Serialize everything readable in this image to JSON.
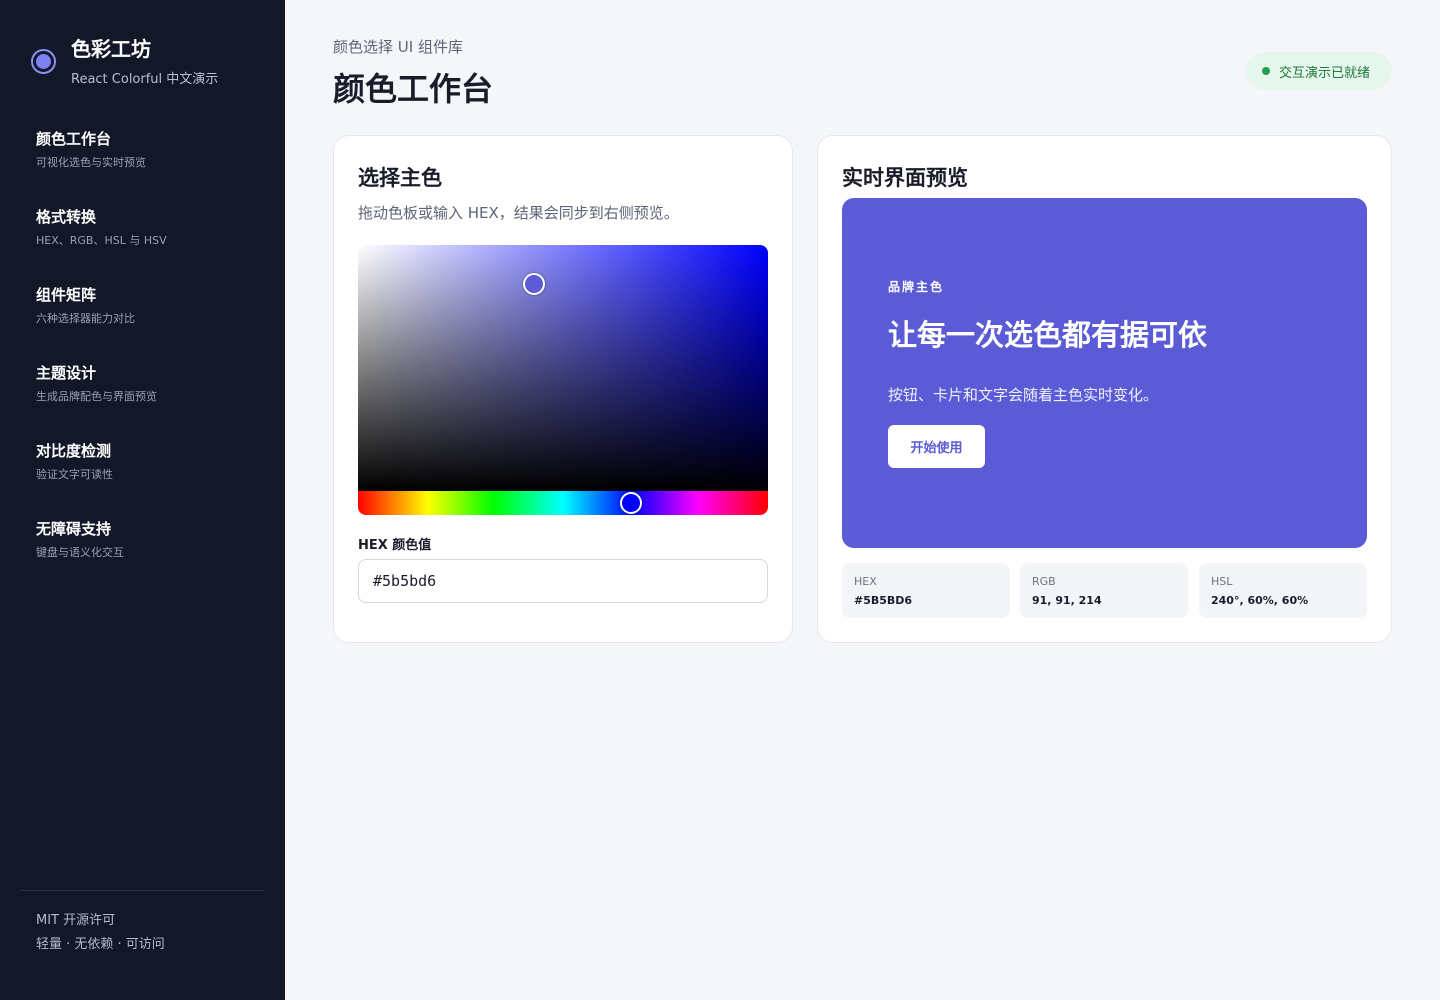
{
  "brand": {
    "title": "色彩工坊",
    "subtitle": "React Colorful 中文演示"
  },
  "nav": [
    {
      "title": "颜色工作台",
      "desc": "可视化选色与实时预览"
    },
    {
      "title": "格式转换",
      "desc": "HEX、RGB、HSL 与 HSV"
    },
    {
      "title": "组件矩阵",
      "desc": "六种选择器能力对比"
    },
    {
      "title": "主题设计",
      "desc": "生成品牌配色与界面预览"
    },
    {
      "title": "对比度检测",
      "desc": "验证文字可读性"
    },
    {
      "title": "无障碍支持",
      "desc": "键盘与语义化交互"
    }
  ],
  "footer": {
    "license": "MIT 开源许可",
    "tagline": "轻量 · 无依赖 · 可访问"
  },
  "header": {
    "kicker": "颜色选择 UI 组件库",
    "title": "颜色工作台",
    "status": "交互演示已就绪"
  },
  "picker": {
    "title": "选择主色",
    "desc": "拖动色板或输入 HEX，结果会同步到右侧预览。",
    "hex_label": "HEX 颜色值",
    "hex_value": "#5b5bd6",
    "hue": 240,
    "saturation_hsv": 0.43,
    "value_hsv": 0.84
  },
  "preview": {
    "title": "实时界面预览",
    "kicker": "品牌主色",
    "headline": "让每一次选色都有据可依",
    "desc": "按钮、卡片和文字会随着主色实时变化。",
    "button": "开始使用",
    "color": "#5b5bd6"
  },
  "values": [
    {
      "label": "HEX",
      "value": "#5B5BD6"
    },
    {
      "label": "RGB",
      "value": "91, 91, 214"
    },
    {
      "label": "HSL",
      "value": "240°, 60%, 60%"
    }
  ]
}
